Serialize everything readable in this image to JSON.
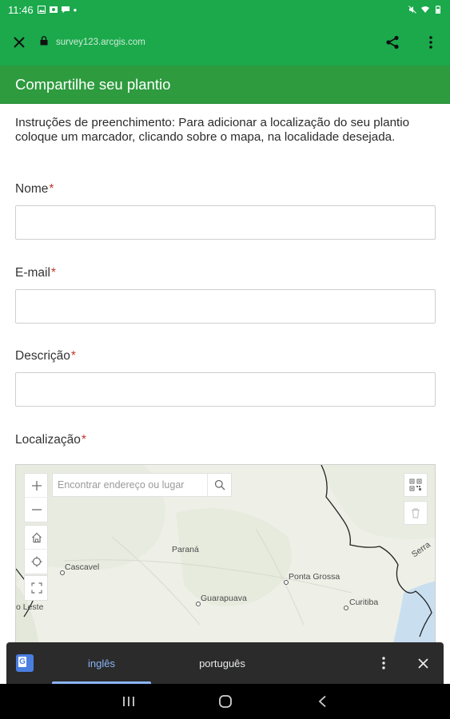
{
  "status_bar": {
    "time": "11:46",
    "dot": "•",
    "left_icons": [
      "image-icon",
      "photos-icon",
      "chat-icon"
    ],
    "right_icons": [
      "mute-icon",
      "wifi-icon",
      "battery-icon"
    ]
  },
  "browser": {
    "close_icon": "close-icon",
    "lock_icon": "lock-icon",
    "url": "survey123.arcgis.com",
    "share_icon": "share-icon",
    "menu_icon": "more-vert-icon"
  },
  "form": {
    "title": "Compartilhe seu plantio",
    "instructions": "Instruções de preenchimento: Para adicionar a localização do seu plantio coloque um marcador, clicando sobre o mapa, na localidade desejada.",
    "required_mark": "*",
    "fields": [
      {
        "label": "Nome",
        "value": ""
      },
      {
        "label": "E-mail",
        "value": ""
      },
      {
        "label": "Descrição",
        "value": ""
      },
      {
        "label": "Localização"
      }
    ]
  },
  "map": {
    "search_placeholder": "Encontrar endereço ou lugar",
    "places": {
      "parana": "Paraná",
      "cascavel": "Cascavel",
      "ponta_grossa": "Ponta Grossa",
      "guarapuava": "Guarapuava",
      "curitiba": "Curitiba",
      "leste": "o Leste",
      "serra": "Serra"
    }
  },
  "translate_bar": {
    "languages": [
      "inglês",
      "português"
    ],
    "active": "inglês"
  },
  "colors": {
    "status_green": "#1ba94c",
    "header_green": "#2e9b3e",
    "required_red": "#c0392b",
    "translate_accent": "#8ab4f8"
  }
}
